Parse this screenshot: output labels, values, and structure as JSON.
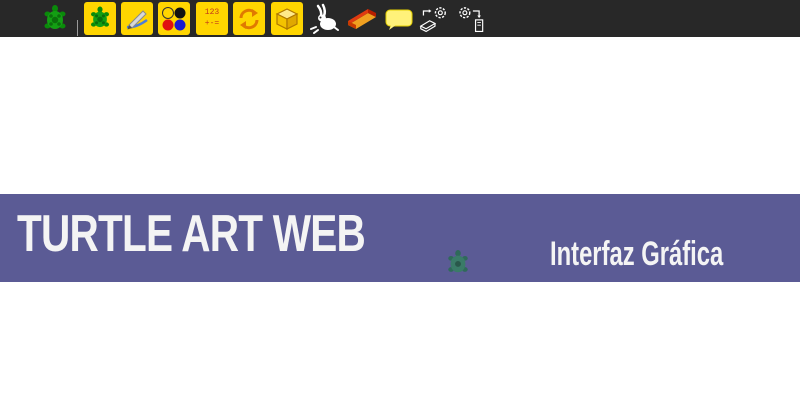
{
  "toolbar": {
    "buttons": [
      {
        "name": "logo-turtle",
        "icon": "turtle-icon"
      },
      {
        "name": "turtle-palette",
        "icon": "turtle-icon"
      },
      {
        "name": "pen-palette",
        "icon": "pen-icon"
      },
      {
        "name": "colors-palette",
        "icon": "color-dots-icon"
      },
      {
        "name": "numbers-palette",
        "icon": "calculator-icon",
        "text_top": "123",
        "text_bottom": "+-="
      },
      {
        "name": "flow-palette",
        "icon": "repeat-arrows-icon"
      },
      {
        "name": "blocks-palette",
        "icon": "box-icon"
      },
      {
        "name": "run-fast",
        "icon": "rabbit-icon"
      },
      {
        "name": "clear",
        "icon": "eraser-icon"
      },
      {
        "name": "hide-blocks",
        "icon": "speech-bubble-icon"
      },
      {
        "name": "save-project",
        "icon": "gear-export-icon"
      },
      {
        "name": "load-project",
        "icon": "gear-import-icon"
      }
    ],
    "colors": {
      "background": "#282828",
      "button_yellow": "#ffd500",
      "turtle_green": "#139e13"
    }
  },
  "banner": {
    "title": "TURTLE ART WEB",
    "subtitle": "Interfaz Gráfica",
    "background": "#5b5b95",
    "text_color": "#f4f4f4"
  }
}
